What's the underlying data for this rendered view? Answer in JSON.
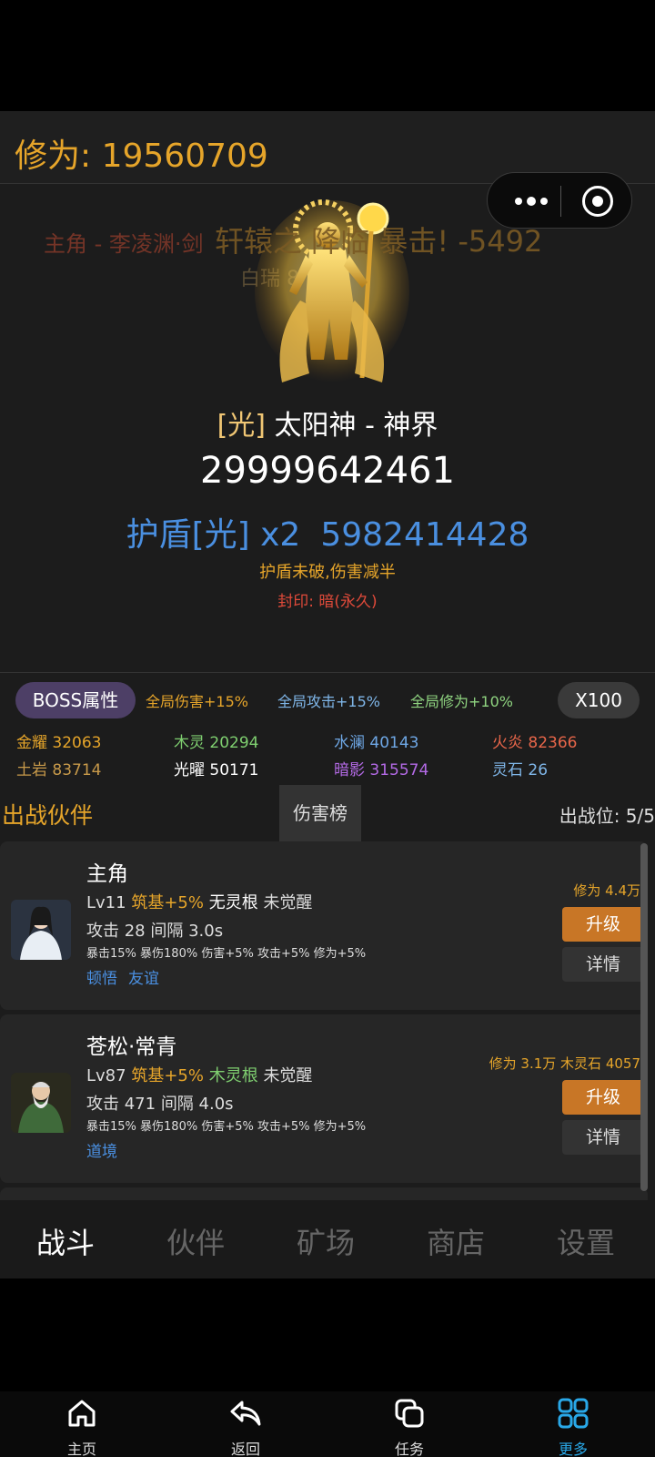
{
  "header": {
    "cultivation_label": "修为: 19560709"
  },
  "floating_texts": {
    "text1": "主角 - 李凌渊·剑",
    "text2": "轩辕之 降临 暴击! -5492",
    "text3": "白瑞 8"
  },
  "boss": {
    "element_tag": "[光]",
    "name": "太阳神 - 神界",
    "hp": "29999642461",
    "shield_label": "护盾[光] x2",
    "shield_value": "5982414428",
    "shield_note": "护盾未破,伤害减半",
    "seal": "封印: 暗(永久)"
  },
  "attributes": {
    "boss_button": "BOSS属性",
    "buffs": [
      "全局伤害+15%",
      "全局攻击+15%",
      "全局修为+10%"
    ],
    "multiplier_button": "X100",
    "resources": [
      {
        "label": "金耀 32063",
        "color": "#e6a52a"
      },
      {
        "label": "木灵 20294",
        "color": "#7fcf70"
      },
      {
        "label": "水澜 40143",
        "color": "#6fa8e6"
      },
      {
        "label": "火炎 82366",
        "color": "#e8664a"
      },
      {
        "label": "土岩 83714",
        "color": "#c89a4a"
      },
      {
        "label": "光曜 50171",
        "color": "#ffffff"
      },
      {
        "label": "暗影 315574",
        "color": "#b46ae6"
      },
      {
        "label": "灵石 26",
        "color": "#7fb6e8"
      }
    ]
  },
  "partners": {
    "title": "出战伙伴",
    "ranking_tab": "伤害榜",
    "slots": "出战位: 5/5",
    "items": [
      {
        "name": "主角",
        "level": "Lv11",
        "realm": "筑基+5%",
        "root": "无灵根",
        "awaken": "未觉醒",
        "attack": "攻击 28",
        "interval": "间隔 3.0s",
        "stats": "暴击15% 暴伤180% 伤害+5% 攻击+5% 修为+5%",
        "tags": [
          "顿悟",
          "友谊"
        ],
        "cost": "修为 4.4万",
        "upgrade_label": "升级",
        "detail_label": "详情"
      },
      {
        "name": "苍松·常青",
        "level": "Lv87",
        "realm": "筑基+5%",
        "root": "木灵根",
        "awaken": "未觉醒",
        "attack": "攻击 471",
        "interval": "间隔 4.0s",
        "stats": "暴击15% 暴伤180% 伤害+5% 攻击+5% 修为+5%",
        "tags": [
          "道境"
        ],
        "cost": "修为 3.1万  木灵石 4057",
        "upgrade_label": "升级",
        "detail_label": "详情"
      }
    ]
  },
  "game_tabs": [
    "战斗",
    "伙伴",
    "矿场",
    "商店",
    "设置"
  ],
  "system_nav": [
    {
      "label": "主页",
      "icon": "home-icon"
    },
    {
      "label": "返回",
      "icon": "back-arrow-icon"
    },
    {
      "label": "任务",
      "icon": "tasks-icon"
    },
    {
      "label": "更多",
      "icon": "grid-icon"
    }
  ]
}
